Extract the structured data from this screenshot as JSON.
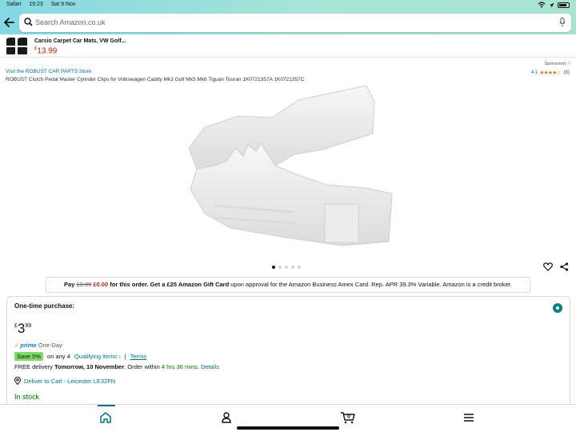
{
  "status_bar": {
    "app": "Safari",
    "time": "19:23",
    "date": "Sat 9 Nov"
  },
  "search": {
    "placeholder": "Search Amazon.co.uk"
  },
  "sponsored_product": {
    "title": "Carsio Carpet Car Mats, VW Golf...",
    "currency": "£",
    "price": "13.99"
  },
  "sponsored_label": "Sponsored",
  "store_link": "Visit the ROBUST CAR PARTS Store",
  "rating": {
    "value": "4.1",
    "stars": "★★★★☆",
    "count": "(8)"
  },
  "product_title": "ROBUST Clutch Pedal Master Cylinder Clips for Volkswagen Caddy Mk3 Golf Mk5 Mk6 Tiguan Touran 1K0721357A 1K0721357C",
  "carousel": {
    "total": 5,
    "active": 0
  },
  "promo": {
    "pay": "Pay",
    "old_price": "£3.99",
    "new_price": "£0.00",
    "bold_text": "for this order. Get a £25 Amazon Gift Card",
    "rest": "upon approval for the Amazon Business Amex Card. Rep. APR 39.3% Variable. Amazon is a credit broker."
  },
  "purchase": {
    "heading": "One-time purchase:",
    "currency": "£",
    "price_whole": "3",
    "price_fraction": "99",
    "prime": "prime",
    "prime_speed": "One-Day",
    "save_badge": "Save 5%",
    "save_on": "on any 4",
    "qualifying": "Qualifying items ›",
    "separator": "|",
    "terms": "Terms",
    "delivery_prefix": "FREE delivery",
    "delivery_date": "Tomorrow, 10 November",
    "delivery_mid": ". Order within",
    "delivery_window": "4 hrs 36 mins",
    "delivery_details": "Details",
    "deliver_to": "Deliver to Carl - Leicester LE32FN",
    "stock": "In stock"
  },
  "bottom_nav": {
    "cart_count": "0"
  },
  "colors": {
    "accent": "#007185",
    "price_red": "#b12704",
    "in_stock_green": "#007600"
  }
}
